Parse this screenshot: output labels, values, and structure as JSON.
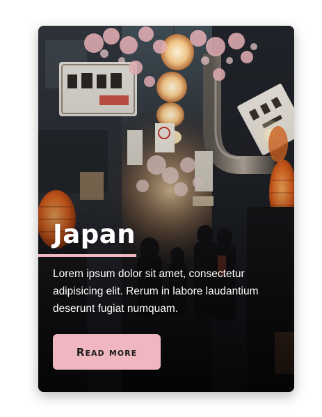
{
  "card": {
    "title": "Japan",
    "body": "Lorem ipsum dolor sit amet, consectetur adipisicing elit. Rerum in labore laudantium deserunt fugiat numquam.",
    "button_label": "Read more"
  },
  "colors": {
    "accent": "#f1b7c1",
    "text": "#ffffff",
    "button_text": "#1a1a1a",
    "card_overlay": "#1b1a1f"
  }
}
